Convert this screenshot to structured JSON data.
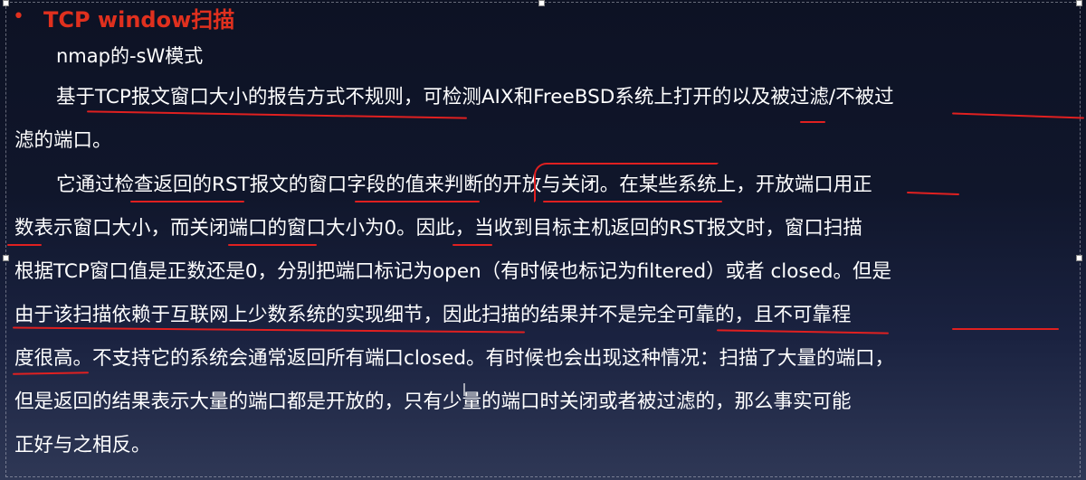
{
  "heading": {
    "bullet": "•",
    "title": "TCP window扫描"
  },
  "subtitle": "nmap的-sW模式",
  "paragraphs": {
    "p1_line1": "基于TCP报文窗口大小的报告方式不规则，可检测AIX和FreeBSD系统上打开的以及被过滤/不被过",
    "p1_line2": "滤的端口。",
    "p2_line1": "它通过检查返回的RST报文的窗口字段的值来判断的开放与关闭。在某些系统上，开放端口用正",
    "p2_line2": "数表示窗口大小，而关闭端口的窗口大小为0。因此，当收到目标主机返回的RST报文时，窗口扫描",
    "p2_line3": "根据TCP窗口值是正数还是0，分别把端口标记为open（有时候也标记为filtered）或者 closed。但是",
    "p2_line4": "由于该扫描依赖于互联网上少数系统的实现细节，因此扫描的结果并不是完全可靠的，且不可靠程",
    "p2_line5": "度很高。不支持它的系统会通常返回所有端口closed。有时候也会出现这种情况：扫描了大量的端口，",
    "p2_line6": "但是返回的结果表示大量的端口都是开放的，只有少量的端口时关闭或者被过滤的，那么事实可能",
    "p2_line7": "正好与之相反。"
  },
  "colors": {
    "heading": "#e0301e",
    "text": "#ffffff",
    "annotation": "#e02020"
  }
}
